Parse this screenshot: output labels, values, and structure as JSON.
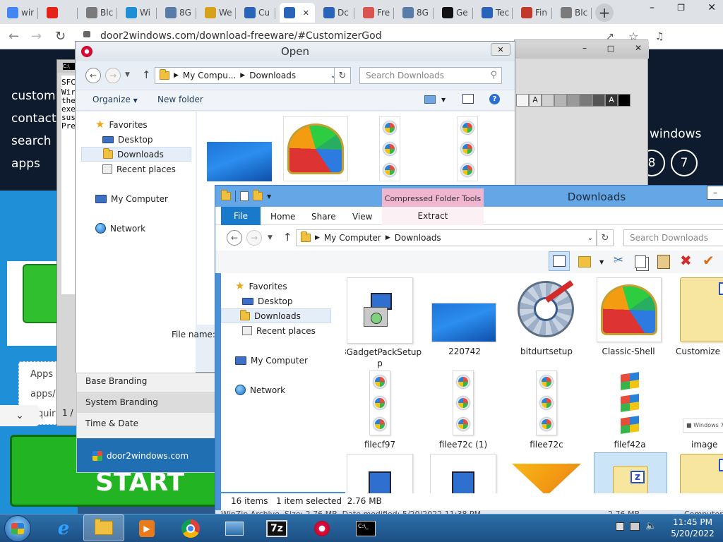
{
  "browser": {
    "tabs": [
      {
        "label": "wir",
        "color": "#4285f4"
      },
      {
        "label": "",
        "color": "#e62117"
      },
      {
        "label": "Blc",
        "color": "#7a7a7a"
      },
      {
        "label": "Wi",
        "color": "#1e8fd6"
      },
      {
        "label": "8G",
        "color": "#5a7aa8"
      },
      {
        "label": "We",
        "color": "#d6a21a"
      },
      {
        "label": "Cu",
        "color": "#2a64b8"
      },
      {
        "label": "",
        "color": "#2a64b8"
      },
      {
        "label": "Dc",
        "color": "#2a64b8"
      },
      {
        "label": "Fre",
        "color": "#d9534f"
      },
      {
        "label": "8G",
        "color": "#5a7aa8"
      },
      {
        "label": "Ge",
        "color": "#111111"
      },
      {
        "label": "Tec",
        "color": "#2a64b8"
      },
      {
        "label": "Fin",
        "color": "#c0392b"
      },
      {
        "label": "Blc",
        "color": "#7a7a7a"
      }
    ],
    "new_tab": "+",
    "url": "door2windows.com/download-freeware/#CustomizerGod"
  },
  "website": {
    "nav": [
      "customi",
      "contact",
      "search",
      "apps"
    ],
    "windows_label": "windows",
    "circle_a": "8",
    "circle_b": "7",
    "apps_text": "Apps",
    "apps_path": "apps/",
    "qui": "quir",
    "start_label": "START"
  },
  "console": {
    "title": "C:\\",
    "lines": [
      "SFC",
      "",
      "Wir",
      "the",
      "exe",
      "sus",
      "",
      "Pre"
    ]
  },
  "customizer": {
    "rows": [
      "Base Branding",
      "System Branding",
      "Time & Date"
    ],
    "page": "1 /",
    "footer_link": "door2windows.com",
    "swatch_text": "A"
  },
  "open_dialog": {
    "title": "Open",
    "breadcrumb": [
      "My Compu...",
      "Downloads"
    ],
    "search_placeholder": "Search Downloads",
    "organize": "Organize",
    "new_folder": "New folder",
    "tree": {
      "favorites": "Favorites",
      "desktop": "Desktop",
      "downloads": "Downloads",
      "recent": "Recent places",
      "computer": "My Computer",
      "network": "Network"
    },
    "file_name_label": "File name:"
  },
  "explorer": {
    "title": "Downloads",
    "context_tab": "Compressed Folder Tools",
    "ribbon_tabs": {
      "file": "File",
      "home": "Home",
      "share": "Share",
      "view": "View",
      "extract": "Extract"
    },
    "breadcrumb": [
      "My Computer",
      "Downloads"
    ],
    "search_placeholder": "Search Downloads",
    "tree": {
      "favorites": "Favorites",
      "desktop": "Desktop",
      "downloads": "Downloads",
      "recent": "Recent places",
      "computer": "My Computer",
      "network": "Network"
    },
    "files": [
      "8GadgetPackSetup",
      "220742",
      "bitdurtsetup",
      "Classic-Shell",
      "Customize",
      "filecf97",
      "filee72c (1)",
      "filee72c",
      "filef42a",
      "image"
    ],
    "status_items": "16 items",
    "status_selected": "1 item selected  2.76 MB",
    "details_left": "WinZip Archive  Size: 2.76 MB  Date modified: 5/20/2022 11:38 PM",
    "details_size": "2.76 MB",
    "details_right": "Computer"
  },
  "taskbar": {
    "time": "11:45 PM",
    "date": "5/20/2022",
    "sevenzip": "7z"
  }
}
